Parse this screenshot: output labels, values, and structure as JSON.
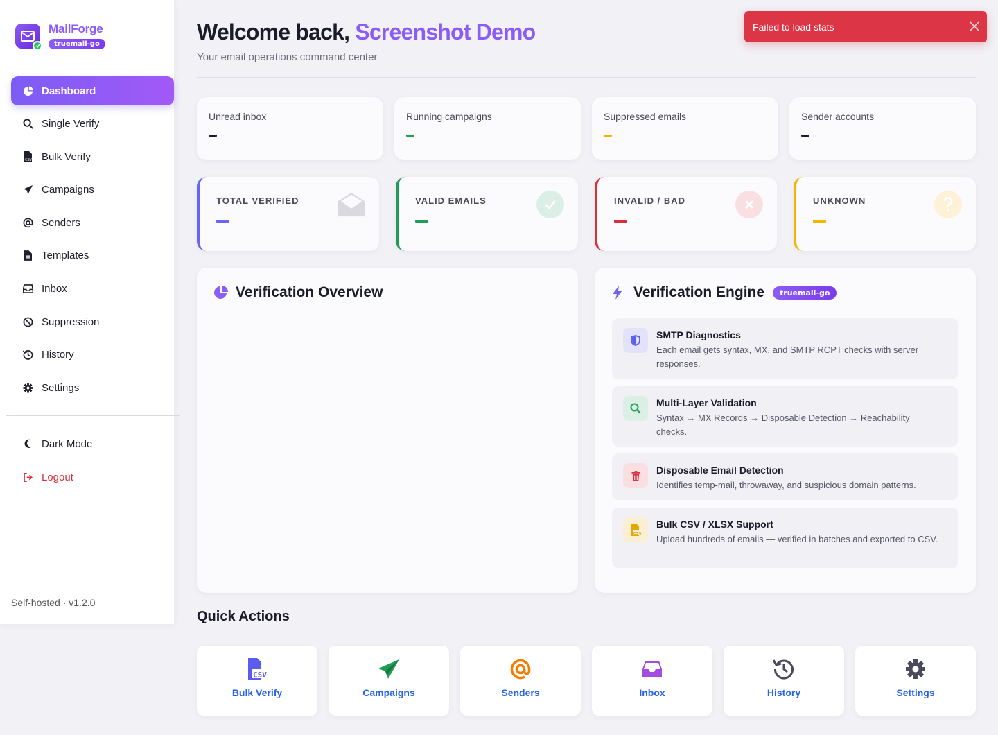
{
  "brand": {
    "name": "MailForge",
    "badge": "truemail-go"
  },
  "nav": {
    "items": [
      {
        "label": "Dashboard",
        "icon": "pie-chart-icon",
        "active": true
      },
      {
        "label": "Single Verify",
        "icon": "search-icon"
      },
      {
        "label": "Bulk Verify",
        "icon": "csv-file-icon"
      },
      {
        "label": "Campaigns",
        "icon": "paper-plane-icon"
      },
      {
        "label": "Senders",
        "icon": "at-icon"
      },
      {
        "label": "Templates",
        "icon": "file-icon"
      },
      {
        "label": "Inbox",
        "icon": "inbox-icon"
      },
      {
        "label": "Suppression",
        "icon": "ban-icon"
      },
      {
        "label": "History",
        "icon": "history-icon"
      },
      {
        "label": "Settings",
        "icon": "gear-icon"
      }
    ],
    "dark_mode": "Dark Mode",
    "logout": "Logout"
  },
  "footer": {
    "version": "Self-hosted · v1.2.0"
  },
  "header": {
    "welcome": "Welcome back,",
    "user": "Screenshot Demo",
    "subtitle": "Your email operations command center"
  },
  "toast": {
    "message": "Failed to load stats"
  },
  "stats": [
    {
      "label": "Unread inbox",
      "value": "–",
      "color": "#1b1b2a"
    },
    {
      "label": "Running campaigns",
      "value": "–",
      "color": "#1f9d55"
    },
    {
      "label": "Suppressed emails",
      "value": "–",
      "color": "#f5b400"
    },
    {
      "label": "Sender accounts",
      "value": "–",
      "color": "#1b1b2a"
    }
  ],
  "kpis": [
    {
      "label": "TOTAL VERIFIED",
      "value": "–",
      "color": "#6c63f0",
      "icon": "envelope-open-icon"
    },
    {
      "label": "VALID EMAILS",
      "value": "–",
      "color": "#1f9d55",
      "icon": "check-circle-icon"
    },
    {
      "label": "INVALID / BAD",
      "value": "–",
      "color": "#dc2f3c",
      "icon": "x-circle-icon"
    },
    {
      "label": "UNKNOWN",
      "value": "–",
      "color": "#f5b400",
      "icon": "question-circle-icon"
    }
  ],
  "overview": {
    "title": "Verification Overview"
  },
  "engine": {
    "title": "Verification Engine",
    "badge": "truemail-go",
    "features": [
      {
        "title": "SMTP Diagnostics",
        "desc": "Each email gets syntax, MX, and SMTP RCPT checks with server responses.",
        "icon": "shield-icon"
      },
      {
        "title": "Multi-Layer Validation",
        "desc": "Syntax → MX Records → Disposable Detection → Reachability checks.",
        "icon": "search-icon"
      },
      {
        "title": "Disposable Email Detection",
        "desc": "Identifies temp-mail, throwaway, and suspicious domain patterns.",
        "icon": "trash-icon"
      },
      {
        "title": "Bulk CSV / XLSX Support",
        "desc": "Upload hundreds of emails — verified in batches and exported to CSV.",
        "icon": "csv-file-icon"
      }
    ]
  },
  "quick_actions": {
    "title": "Quick Actions",
    "items": [
      {
        "label": "Bulk Verify",
        "icon": "csv-file-icon",
        "color": "#5b5bf0"
      },
      {
        "label": "Campaigns",
        "icon": "paper-plane-icon",
        "color": "#1f9d55"
      },
      {
        "label": "Senders",
        "icon": "at-icon",
        "color": "#f57c00"
      },
      {
        "label": "Inbox",
        "icon": "inbox-icon",
        "color": "#a34ce0"
      },
      {
        "label": "History",
        "icon": "history-icon",
        "color": "#4a4a5a"
      },
      {
        "label": "Settings",
        "icon": "gear-icon",
        "color": "#4a4a5a"
      }
    ]
  }
}
